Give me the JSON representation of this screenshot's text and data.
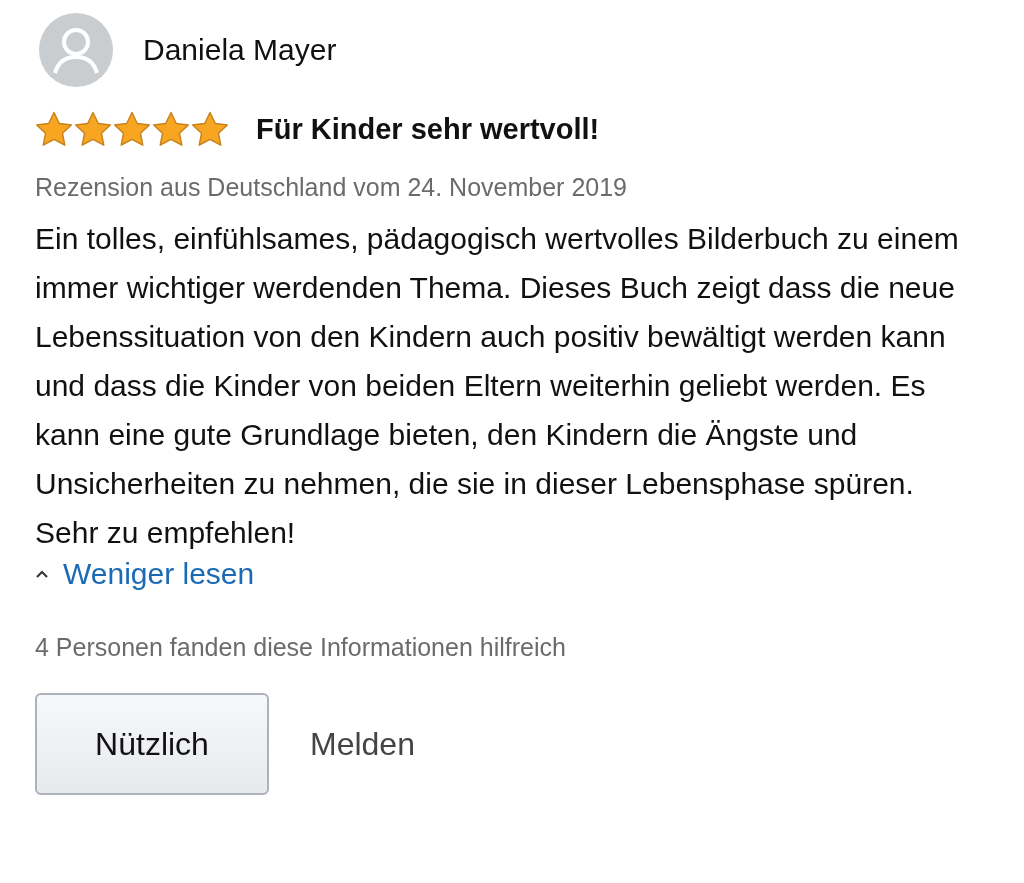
{
  "review": {
    "author": "Daniela Mayer",
    "stars": 5,
    "title": "Für Kinder sehr wertvoll!",
    "meta": "Rezension aus Deutschland vom 24. November 2019",
    "body": "Ein tolles, einfühlsames, pädagogisch wertvolles Bilderbuch zu einem immer wichtiger werdenden Thema. Dieses Buch zeigt dass die neue Lebenssituation von den Kindern auch positiv bewältigt werden kann und dass die Kinder von beiden Eltern weiterhin geliebt werden. Es kann eine gute Grundlage bieten, den Kindern die Ängste und Unsicherheiten zu nehmen, die sie in dieser Lebensphase spüren. Sehr zu empfehlen!",
    "toggle": "Weniger lesen",
    "expanded": true,
    "helpful": "4 Personen fanden diese Informationen hilfreich",
    "buttons": [
      {
        "kind": "primary",
        "label": "Nützlich"
      },
      {
        "kind": "link",
        "label": "Melden"
      }
    ]
  }
}
